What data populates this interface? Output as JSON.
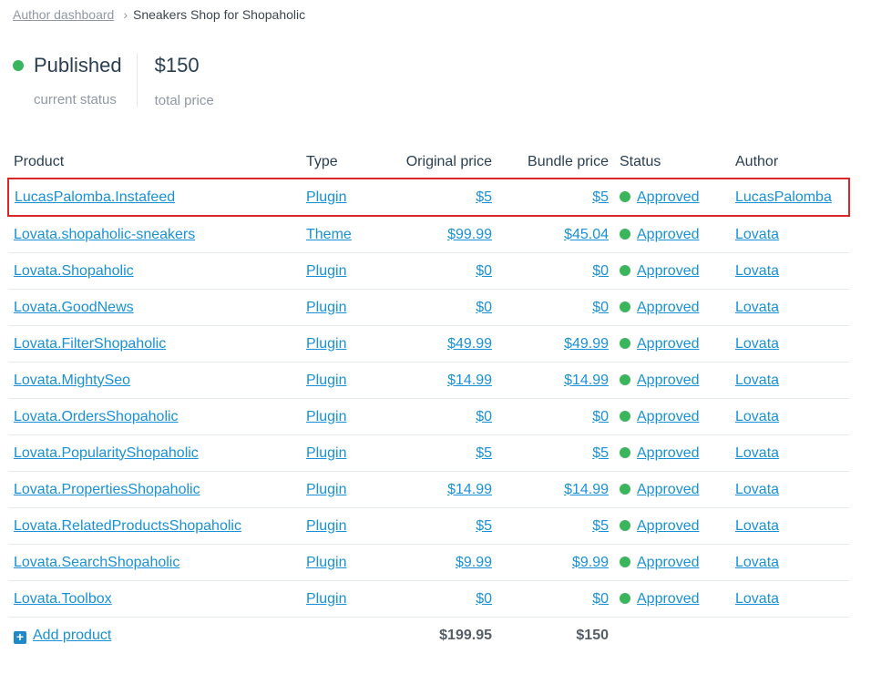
{
  "breadcrumb": {
    "parent": "Author dashboard",
    "current": "Sneakers Shop for Shopaholic"
  },
  "summary": {
    "status_value": "Published",
    "status_label": "current status",
    "price_value": "$150",
    "price_label": "total price"
  },
  "table": {
    "headers": [
      "Product",
      "Type",
      "Original price",
      "Bundle price",
      "Status",
      "Author"
    ],
    "rows": [
      {
        "product": "LucasPalomba.Instafeed",
        "type": "Plugin",
        "original": "$5",
        "bundle": "$5",
        "status": "Approved",
        "author": "LucasPalomba"
      },
      {
        "product": "Lovata.shopaholic-sneakers",
        "type": "Theme",
        "original": "$99.99",
        "bundle": "$45.04",
        "status": "Approved",
        "author": "Lovata"
      },
      {
        "product": "Lovata.Shopaholic",
        "type": "Plugin",
        "original": "$0",
        "bundle": "$0",
        "status": "Approved",
        "author": "Lovata"
      },
      {
        "product": "Lovata.GoodNews",
        "type": "Plugin",
        "original": "$0",
        "bundle": "$0",
        "status": "Approved",
        "author": "Lovata"
      },
      {
        "product": "Lovata.FilterShopaholic",
        "type": "Plugin",
        "original": "$49.99",
        "bundle": "$49.99",
        "status": "Approved",
        "author": "Lovata"
      },
      {
        "product": "Lovata.MightySeo",
        "type": "Plugin",
        "original": "$14.99",
        "bundle": "$14.99",
        "status": "Approved",
        "author": "Lovata"
      },
      {
        "product": "Lovata.OrdersShopaholic",
        "type": "Plugin",
        "original": "$0",
        "bundle": "$0",
        "status": "Approved",
        "author": "Lovata"
      },
      {
        "product": "Lovata.PopularityShopaholic",
        "type": "Plugin",
        "original": "$5",
        "bundle": "$5",
        "status": "Approved",
        "author": "Lovata"
      },
      {
        "product": "Lovata.PropertiesShopaholic",
        "type": "Plugin",
        "original": "$14.99",
        "bundle": "$14.99",
        "status": "Approved",
        "author": "Lovata"
      },
      {
        "product": "Lovata.RelatedProductsShopaholic",
        "type": "Plugin",
        "original": "$5",
        "bundle": "$5",
        "status": "Approved",
        "author": "Lovata"
      },
      {
        "product": "Lovata.SearchShopaholic",
        "type": "Plugin",
        "original": "$9.99",
        "bundle": "$9.99",
        "status": "Approved",
        "author": "Lovata"
      },
      {
        "product": "Lovata.Toolbox",
        "type": "Plugin",
        "original": "$0",
        "bundle": "$0",
        "status": "Approved",
        "author": "Lovata"
      }
    ],
    "footer": {
      "add_label": "Add product",
      "original_total": "$199.95",
      "bundle_total": "$150"
    }
  },
  "colors": {
    "link": "#1991d6",
    "approved": "#3ab45d",
    "highlight": "#d8262b",
    "add_icon": "#1f89c9"
  },
  "icons": {
    "breadcrumb_separator": "chevron-right-icon",
    "add": "plus-icon",
    "status": "status-dot-icon"
  }
}
